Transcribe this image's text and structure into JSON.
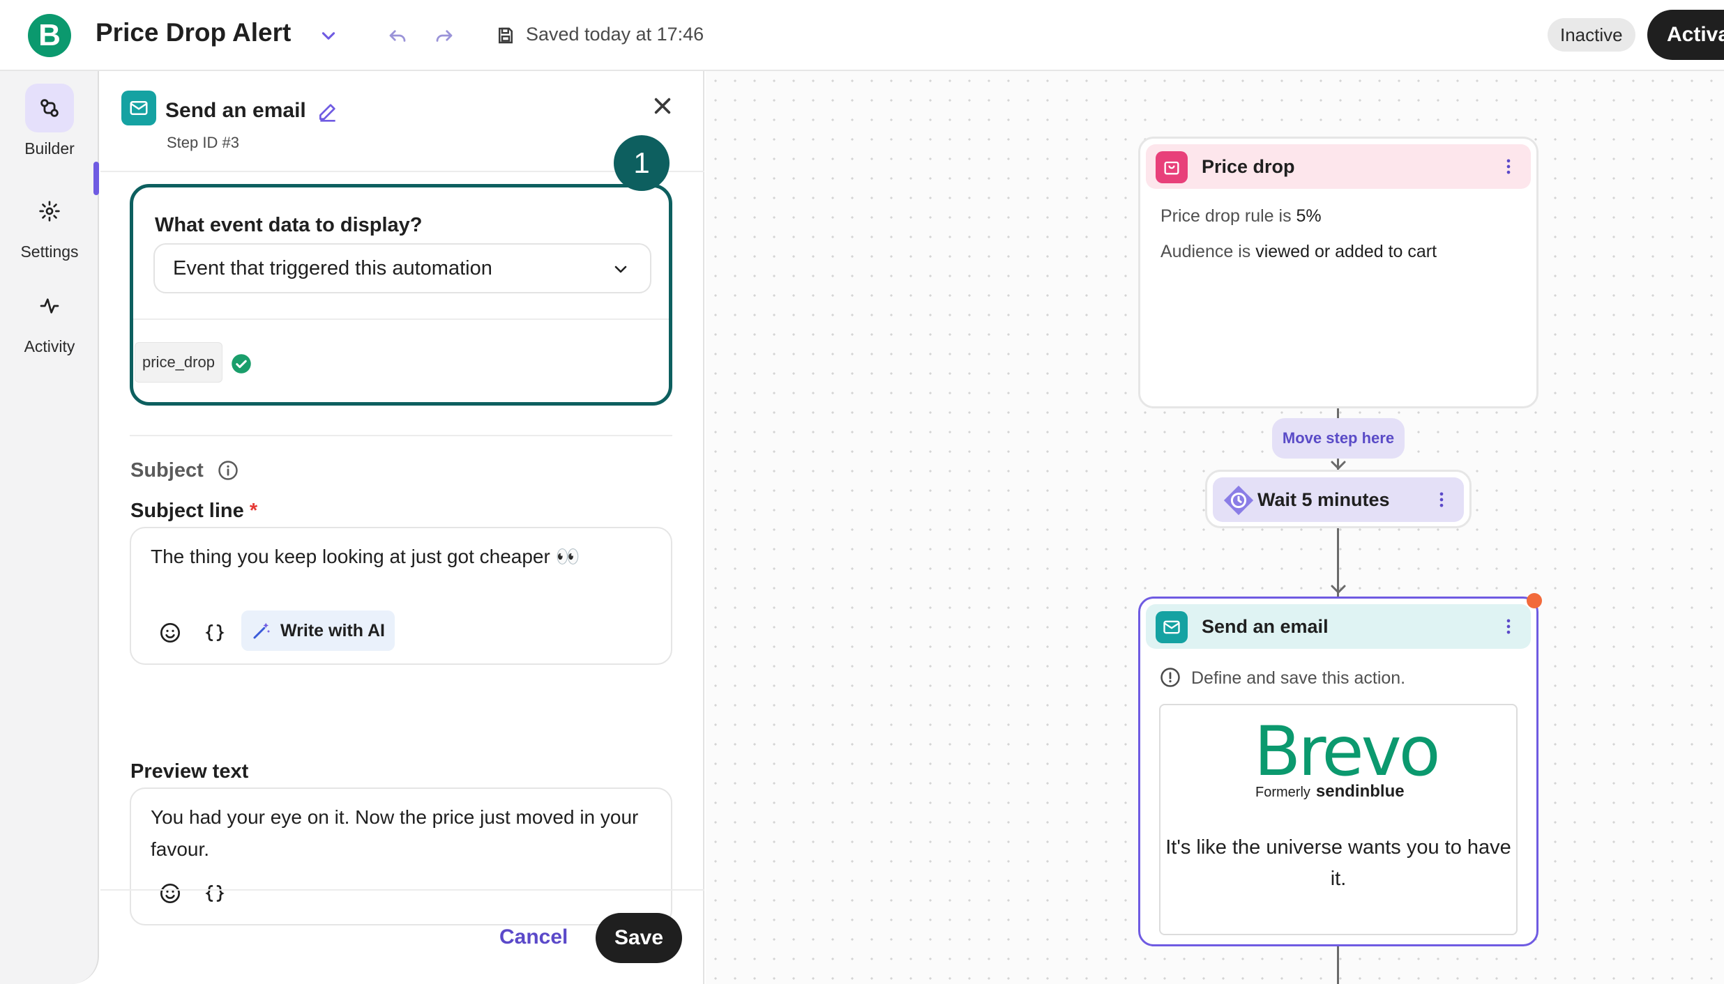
{
  "header": {
    "app_title": "Price Drop Alert",
    "saved_status": "Saved today at 17:46",
    "status_badge": "Inactive",
    "activate_label": "Activate",
    "brand_color": "#0b996e"
  },
  "rail": {
    "items": [
      {
        "label": "Builder",
        "icon": "builder-icon",
        "active": true
      },
      {
        "label": "Settings",
        "icon": "gear-icon",
        "active": false
      },
      {
        "label": "Activity",
        "icon": "activity-icon",
        "active": false
      }
    ]
  },
  "panel": {
    "title": "Send an email",
    "step_id": "Step ID #3",
    "step_marker": "1",
    "event_question": "What event data to display?",
    "event_selected": "Event that triggered this automation",
    "event_tag": "price_drop",
    "subject_heading": "Subject",
    "subject_line_label": "Subject line",
    "required_mark": "*",
    "subject_line_value": "The thing you keep looking at just got cheaper 👀",
    "write_ai_label": "Write with AI",
    "preview_text_label": "Preview text",
    "preview_text_value": "You had your eye on it. Now the price just moved in your favour.",
    "cancel_label": "Cancel",
    "save_label": "Save"
  },
  "canvas": {
    "trigger_node": {
      "title": "Price drop",
      "rule_prefix": "Price drop rule is",
      "rule_value": "5%",
      "audience_prefix": "Audience is",
      "audience_value": "viewed or added to cart",
      "color": "#e8407a"
    },
    "move_step_label": "Move step here",
    "wait_node": {
      "title": "Wait 5 minutes",
      "color": "#8a7de6"
    },
    "email_node": {
      "title": "Send an email",
      "warning": "Define and save this action.",
      "brand_wordmark": "Brevo",
      "formerly_label": "Formerly",
      "formerly_brand": "sendinblue",
      "tagline": "It's like the universe wants you to have it.",
      "color": "#15a2a2"
    }
  }
}
